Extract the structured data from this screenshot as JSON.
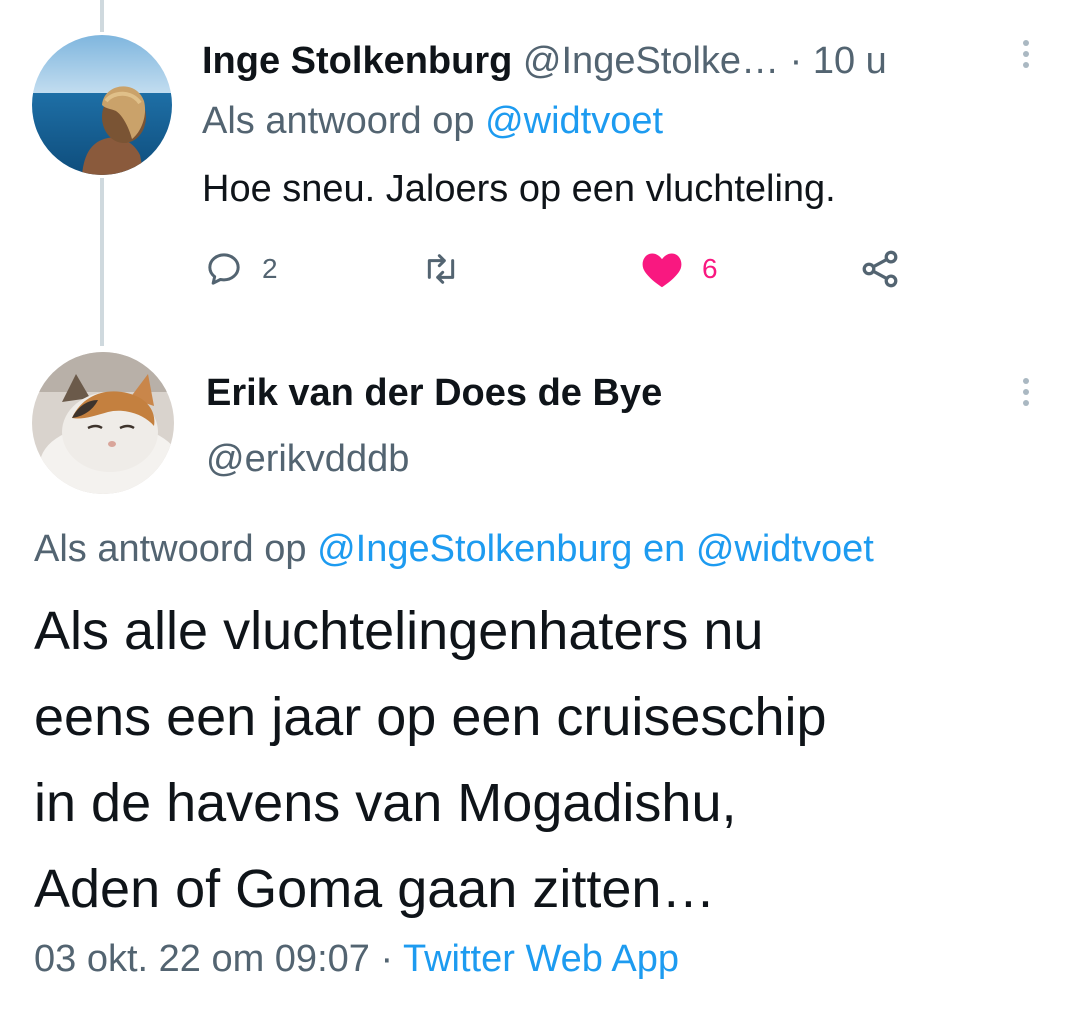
{
  "tweet1": {
    "display_name": "Inge Stolkenburg",
    "handle": "@IngeStolke…",
    "time": "· 10 u",
    "reply_prefix": "Als antwoord op",
    "reply_to": "@widtvoet",
    "text": "Hoe sneu. Jaloers op een vluchteling.",
    "reply_count": "2",
    "like_count": "6",
    "icons": [
      "reply-icon",
      "retweet-icon",
      "heart-icon",
      "share-icon",
      "more-icon"
    ]
  },
  "tweet2": {
    "display_name": "Erik van der Does de Bye",
    "handle": "@erikvdddb",
    "reply_prefix": "Als antwoord op",
    "reply_to_1": "@IngeStolkenburg",
    "reply_joiner": "en",
    "reply_to_2": "@widtvoet",
    "text_lines": [
      "Als alle vluchtelingenhaters nu",
      "eens een jaar op een cruiseschip",
      "in de havens van Mogadishu,",
      "Aden of Goma gaan zitten…"
    ],
    "timestamp": "03 okt. 22 om 09:07",
    "separator": "·",
    "source": "Twitter Web App"
  },
  "colors": {
    "accent": "#1d9bf0",
    "like": "#f91880",
    "muted": "#536471",
    "thread_line": "#cfd9de"
  }
}
